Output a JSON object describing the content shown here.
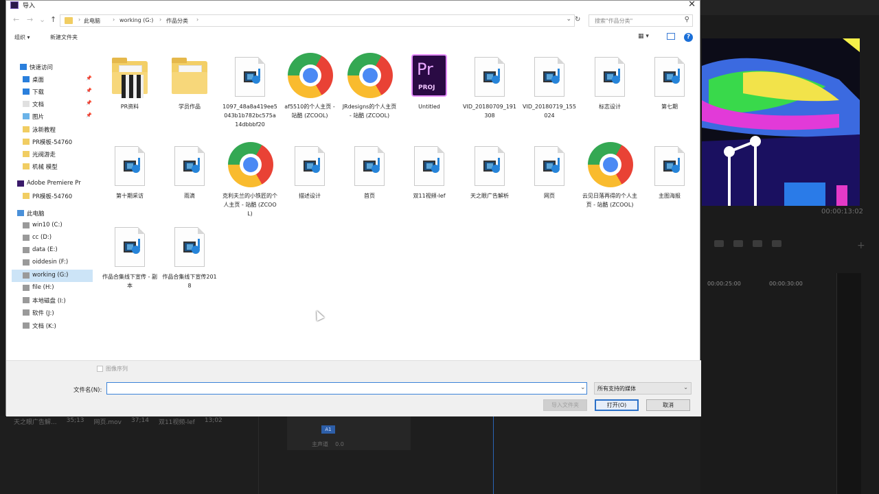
{
  "window": {
    "title": "导入"
  },
  "address": {
    "crumbs": [
      "此电脑",
      "working (G:)",
      "作品分类"
    ],
    "search_placeholder": "搜索\"作品分类\""
  },
  "toolbar": {
    "organize": "组织 ▾",
    "new_folder": "新建文件夹",
    "view": "▦ ▾",
    "help": "?"
  },
  "nav": [
    {
      "label": "快速访问",
      "icon": "star-icon",
      "pinned": false
    },
    {
      "label": "桌面",
      "icon": "desktop-icon",
      "pinned": true
    },
    {
      "label": "下载",
      "icon": "download-icon",
      "pinned": true
    },
    {
      "label": "文档",
      "icon": "document-icon",
      "pinned": true
    },
    {
      "label": "图片",
      "icon": "picture-icon",
      "pinned": true
    },
    {
      "label": "泳新教程",
      "icon": "folder-icon",
      "pinned": false
    },
    {
      "label": "PR模板-54760",
      "icon": "folder-icon",
      "pinned": false
    },
    {
      "label": "光阀游走",
      "icon": "folder-icon",
      "pinned": false
    },
    {
      "label": "机械 模型",
      "icon": "folder-icon",
      "pinned": false
    },
    {
      "label": "Adobe Premiere Pr",
      "icon": "premiere-icon",
      "pinned": false
    },
    {
      "label": "PR模板-54760",
      "icon": "folder-icon",
      "pinned": false
    },
    {
      "label": "此电脑",
      "icon": "computer-icon",
      "pinned": false
    },
    {
      "label": "win10 (C:)",
      "icon": "drive-icon",
      "pinned": false
    },
    {
      "label": "cc (D:)",
      "icon": "drive-icon",
      "pinned": false
    },
    {
      "label": "data (E:)",
      "icon": "drive-icon",
      "pinned": false
    },
    {
      "label": "oiddesin (F:)",
      "icon": "drive-icon",
      "pinned": false
    },
    {
      "label": "working (G:)",
      "icon": "drive-icon",
      "pinned": false
    },
    {
      "label": "file (H:)",
      "icon": "drive-icon",
      "pinned": false
    },
    {
      "label": "本地磁盘 (I:)",
      "icon": "drive-icon",
      "pinned": false
    },
    {
      "label": "软件 (J:)",
      "icon": "drive-icon",
      "pinned": false
    },
    {
      "label": "文档 (K:)",
      "icon": "drive-icon",
      "pinned": false
    }
  ],
  "files": [
    {
      "label": "PR资料",
      "type": "folder"
    },
    {
      "label": "学员作品",
      "type": "folder"
    },
    {
      "label": "1097_48a8a419ee5043b1b782bc575a14dbbbf20",
      "type": "video"
    },
    {
      "label": "af5510的个人主页 - 站酷 (ZCOOL)",
      "type": "chrome"
    },
    {
      "label": "JRdesigns的个人主页 - 站酷 (ZCOOL)",
      "type": "chrome"
    },
    {
      "label": "Untitled",
      "type": "prproj"
    },
    {
      "label": "VID_20180709_191308",
      "type": "video"
    },
    {
      "label": "VID_20180719_155024",
      "type": "video"
    },
    {
      "label": "标志设计",
      "type": "video"
    },
    {
      "label": "第七期",
      "type": "video"
    },
    {
      "label": "第十期采访",
      "type": "video"
    },
    {
      "label": "雨滴",
      "type": "video"
    },
    {
      "label": "克利夫兰的小铁匠的个人主页 - 站酷 (ZCOOL)",
      "type": "chrome"
    },
    {
      "label": "描述设计",
      "type": "video"
    },
    {
      "label": "首页",
      "type": "video"
    },
    {
      "label": "双11视频-lef",
      "type": "video"
    },
    {
      "label": "天之眼广告解析",
      "type": "video"
    },
    {
      "label": "网页",
      "type": "video"
    },
    {
      "label": "云见日落再得的个人主页 - 站酷 (ZCOOL)",
      "type": "chrome"
    },
    {
      "label": "主图海报",
      "type": "video"
    },
    {
      "label": "作品合集线下宣传 - 副本",
      "type": "video"
    },
    {
      "label": "作品合集线下宣传2018",
      "type": "video"
    }
  ],
  "bottom": {
    "image_sequence": "图像序列",
    "filename_label": "文件名(N):",
    "filename_value": "",
    "file_type": "所有支持的媒体",
    "import_folder": "导入文件夹",
    "open": "打开(O)",
    "cancel": "取消"
  },
  "premiere": {
    "timecode": "00:00:13:02",
    "ruler_a": "00:00:25:00",
    "ruler_b": "00:00:30:00",
    "bin_row": [
      "天之眼广告解...",
      "35;13",
      "网页.mov",
      "37;14",
      "双11视频-lef",
      "13;02"
    ],
    "track_a1": "A1",
    "track_label": "主声道",
    "track_value": "0.0"
  }
}
